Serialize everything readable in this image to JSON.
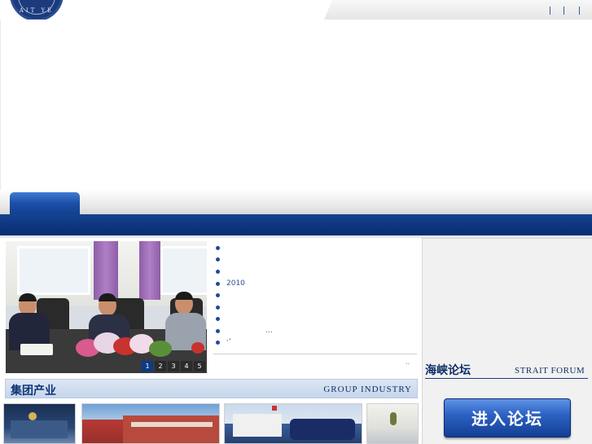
{
  "logo": {
    "ring_text": "AIT YE"
  },
  "slideshow": {
    "pages": [
      "1",
      "2",
      "3",
      "4",
      "5"
    ],
    "active": 1
  },
  "news": {
    "items": [
      {
        "text": ""
      },
      {
        "text": ""
      },
      {
        "text": ""
      },
      {
        "text": "2010"
      },
      {
        "text": ""
      },
      {
        "text": ""
      },
      {
        "text": ""
      },
      {
        "text": "",
        "extra": "..."
      },
      {
        "text": "ˑ’"
      }
    ],
    "more": ".."
  },
  "group_industry": {
    "title_cn": "集团产业",
    "title_en": "GROUP  INDUSTRY"
  },
  "forum": {
    "title_cn": "海峡论坛",
    "title_en": "STRAIT FORUM",
    "button_label": "进入论坛"
  },
  "colors": {
    "navy": "#0d3580",
    "accent": "#1d4a9a",
    "panel": "#f1f1f1"
  }
}
